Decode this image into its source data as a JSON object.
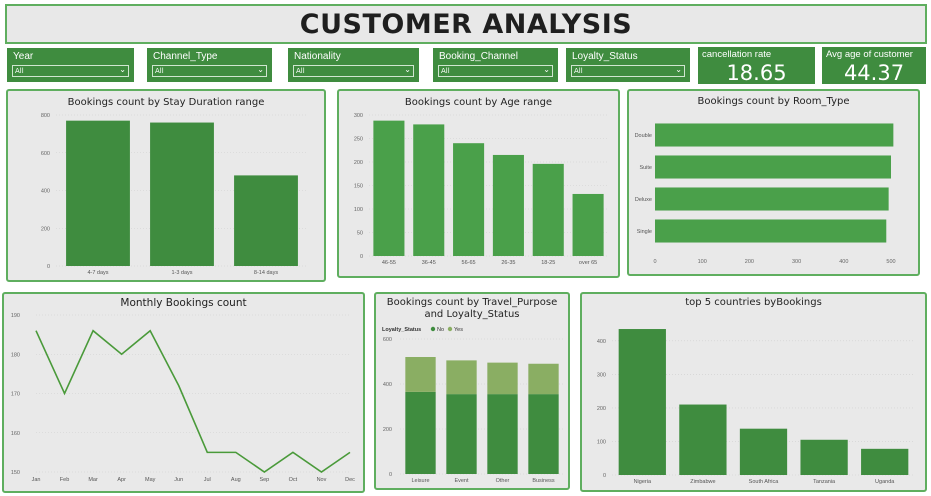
{
  "header": {
    "title": "CUSTOMER ANALYSIS"
  },
  "slicers": [
    {
      "label": "Year",
      "value": "All"
    },
    {
      "label": "Channel_Type",
      "value": "All"
    },
    {
      "label": "Nationality",
      "value": "All"
    },
    {
      "label": "Booking_Channel",
      "value": "All"
    },
    {
      "label": "Loyalty_Status",
      "value": "All"
    }
  ],
  "cards": [
    {
      "label": "cancellation rate",
      "value": "18.65"
    },
    {
      "label": "Avg age of customer",
      "value": "44.37"
    }
  ],
  "colors": {
    "bar": "#3f8c3f",
    "bar_alt": "#4aa04a",
    "light": "#8aae63",
    "line": "#4a9a3a",
    "panel_border": "#5fae5f"
  },
  "chart_data": [
    {
      "id": "stay",
      "type": "bar",
      "title": "Bookings count by Stay Duration range",
      "categories": [
        "4-7 days",
        "1-3 days",
        "8-14 days"
      ],
      "values": [
        770,
        760,
        480
      ],
      "ylim": [
        0,
        800
      ],
      "yticks": [
        "0",
        "200",
        "400",
        "600",
        "800"
      ]
    },
    {
      "id": "age",
      "type": "bar",
      "title": "Bookings count by Age range",
      "categories": [
        "46-55",
        "36-45",
        "56-65",
        "26-35",
        "18-25",
        "over 65"
      ],
      "values": [
        288,
        280,
        240,
        215,
        196,
        132
      ],
      "ylim": [
        0,
        300
      ],
      "yticks": [
        "0",
        "50",
        "100",
        "150",
        "200",
        "250",
        "300"
      ]
    },
    {
      "id": "room",
      "type": "bar",
      "orientation": "horizontal",
      "title": "Bookings count by Room_Type",
      "categories": [
        "Double",
        "Suite",
        "Deluxe",
        "Single"
      ],
      "values": [
        505,
        500,
        495,
        490
      ],
      "xlim": [
        0,
        500
      ],
      "xticks": [
        "0",
        "100",
        "200",
        "300",
        "400",
        "500"
      ]
    },
    {
      "id": "monthly",
      "type": "line",
      "title": "Monthly Bookings count",
      "categories": [
        "Jan",
        "Feb",
        "Mar",
        "Apr",
        "May",
        "Jun",
        "Jul",
        "Aug",
        "Sep",
        "Oct",
        "Nov",
        "Dec"
      ],
      "values": [
        186,
        170,
        186,
        180,
        186,
        172,
        155,
        155,
        150,
        155,
        150,
        155
      ],
      "ylim": [
        150,
        190
      ],
      "yticks": [
        "150",
        "160",
        "170",
        "180",
        "190"
      ]
    },
    {
      "id": "travel",
      "type": "bar",
      "stacked": true,
      "title": "Bookings count by Travel_Purpose and Loyalty_Status",
      "legend_title": "Loyalty_Status",
      "categories": [
        "Leisure",
        "Event",
        "Other",
        "Business"
      ],
      "series": [
        {
          "name": "No",
          "values": [
            365,
            355,
            355,
            355
          ]
        },
        {
          "name": "Yes",
          "values": [
            155,
            150,
            140,
            135
          ]
        }
      ],
      "ylim": [
        0,
        600
      ],
      "yticks": [
        "0",
        "200",
        "400",
        "600"
      ]
    },
    {
      "id": "countries",
      "type": "bar",
      "title": "top 5 countries byBookings",
      "categories": [
        "Nigeria",
        "Zimbabwe",
        "South Africa",
        "Tanzania",
        "Uganda"
      ],
      "values": [
        435,
        210,
        138,
        105,
        78
      ],
      "ylim": [
        0,
        450
      ],
      "yticks": [
        "0",
        "100",
        "200",
        "300",
        "400"
      ]
    }
  ]
}
